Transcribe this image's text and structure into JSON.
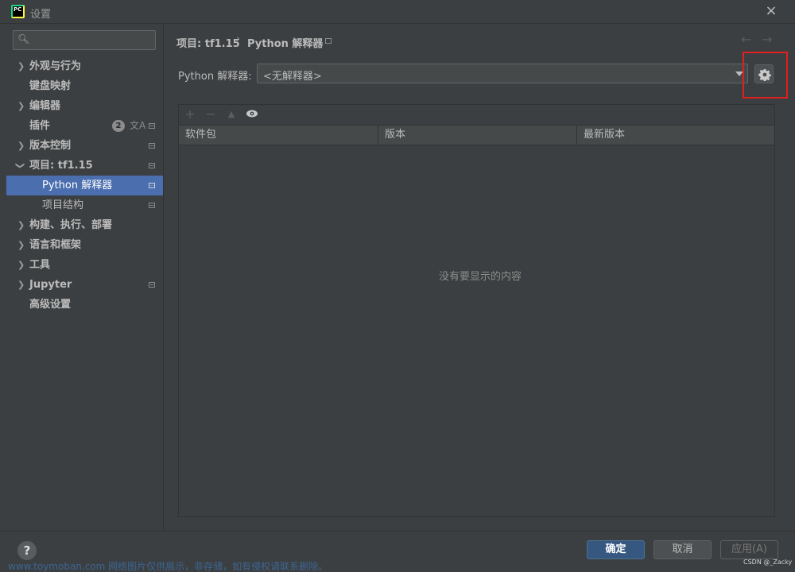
{
  "window": {
    "title": "设置",
    "close_icon": "×"
  },
  "search": {
    "placeholder": "",
    "icon": "search-icon"
  },
  "sidebar": {
    "items": [
      {
        "label": "外观与行为",
        "expandable": true
      },
      {
        "label": "键盘映射",
        "expandable": false
      },
      {
        "label": "编辑器",
        "expandable": true
      },
      {
        "label": "插件",
        "expandable": false,
        "badge": "2"
      },
      {
        "label": "版本控制",
        "expandable": true
      },
      {
        "label": "项目: tf1.15",
        "expandable": true,
        "expanded": true
      },
      {
        "label": "Python 解释器",
        "sub": true,
        "selected": true
      },
      {
        "label": "项目结构",
        "sub": true
      },
      {
        "label": "构建、执行、部署",
        "expandable": true
      },
      {
        "label": "语言和框架",
        "expandable": true
      },
      {
        "label": "工具",
        "expandable": true
      },
      {
        "label": "Jupyter",
        "expandable": true
      },
      {
        "label": "高级设置",
        "expandable": false
      }
    ]
  },
  "breadcrumb": {
    "parent": "项目: tf1.15",
    "separator": "›",
    "current": "Python 解释器"
  },
  "interpreter": {
    "label": "Python 解释器:",
    "value": "<无解释器>"
  },
  "packages": {
    "toolbar": {
      "add": "+",
      "remove": "−",
      "upgrade": "▲",
      "show_early": "eye-icon"
    },
    "columns": [
      "软件包",
      "版本",
      "最新版本"
    ],
    "empty_text": "没有要显示的内容"
  },
  "footer": {
    "help": "?",
    "ok": "确定",
    "cancel": "取消",
    "apply": "应用(A)"
  },
  "overlay": {
    "watermark": "www.toymoban.com 网络图片仅供展示，非存储，如有侵权请联系删除。",
    "credit": "CSDN @_Zacky"
  },
  "colors": {
    "background": "#3c3f41",
    "selection": "#4b6eaf",
    "primary_button": "#365880",
    "highlight": "#e02020"
  }
}
